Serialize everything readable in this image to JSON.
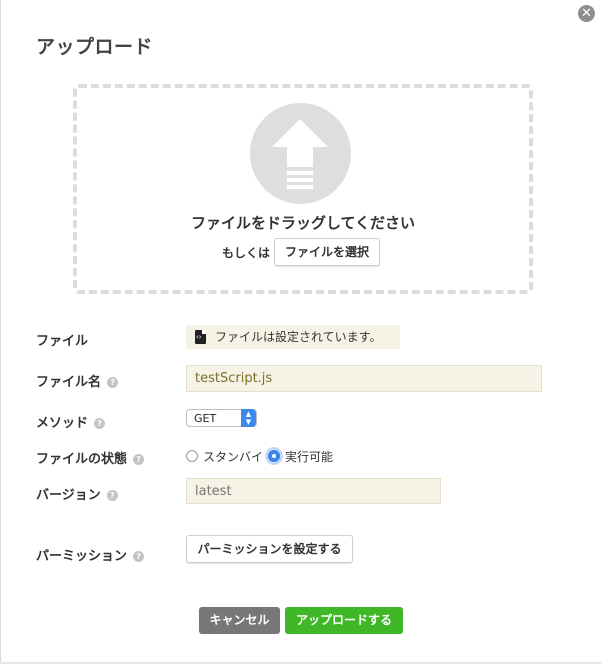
{
  "dialog": {
    "title": "アップロード",
    "close_icon": "close-icon"
  },
  "dropzone": {
    "icon": "upload-arrow-icon",
    "drop_text": "ファイルをドラッグしてください",
    "or_text": "もしくは",
    "select_button": "ファイルを選択"
  },
  "form": {
    "file": {
      "label": "ファイル",
      "status_icon": "code-file-icon",
      "status_text": "ファイルは設定されています。"
    },
    "filename": {
      "label": "ファイル名",
      "value": "testScript.js"
    },
    "method": {
      "label": "メソッド",
      "selected": "GET"
    },
    "state": {
      "label": "ファイルの状態",
      "options": [
        {
          "label": "スタンバイ",
          "checked": false
        },
        {
          "label": "実行可能",
          "checked": true
        }
      ]
    },
    "version": {
      "label": "バージョン",
      "placeholder": "latest"
    },
    "permission": {
      "label": "パーミッション",
      "button": "パーミッションを設定する"
    },
    "help_icon": "?"
  },
  "footer": {
    "cancel": "キャンセル",
    "upload": "アップロードする"
  },
  "colors": {
    "upload_button": "#3fb727",
    "cancel_button": "#777777",
    "input_background": "#f6f3e6",
    "radio_selected": "#3c88ee"
  }
}
